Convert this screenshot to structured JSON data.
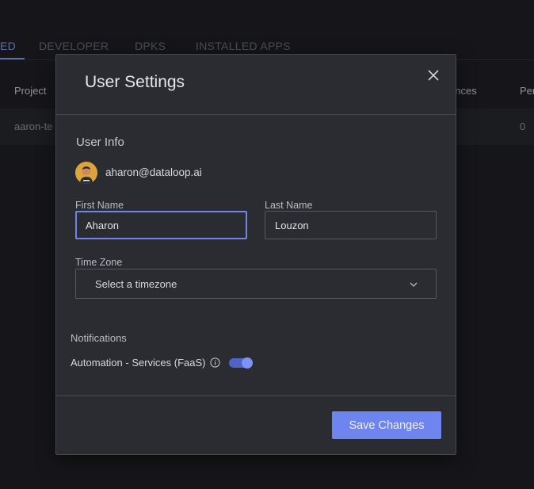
{
  "tabs": [
    "ED",
    "DEVELOPER",
    "DPKS",
    "INSTALLED APPS"
  ],
  "table": {
    "headers": [
      "Project",
      "ances",
      "Per"
    ],
    "row": [
      "aaron-te",
      "0"
    ]
  },
  "dialog": {
    "title": "User Settings",
    "section_title": "User Info",
    "email": "aharon@dataloop.ai",
    "first_name_label": "First Name",
    "first_name_value": "Aharon",
    "last_name_label": "Last Name",
    "last_name_value": "Louzon",
    "timezone_label": "Time Zone",
    "timezone_value": "Select a timezone",
    "notifications_title": "Notifications",
    "notification_item": "Automation - Services (FaaS)",
    "notification_enabled": true,
    "save_label": "Save Changes"
  },
  "colors": {
    "accent": "#6e85f0",
    "dialog_bg": "#2a2c31",
    "page_bg": "#1b1c20"
  },
  "icons": [
    "close-icon",
    "chevron-down-icon",
    "info-icon",
    "avatar"
  ]
}
